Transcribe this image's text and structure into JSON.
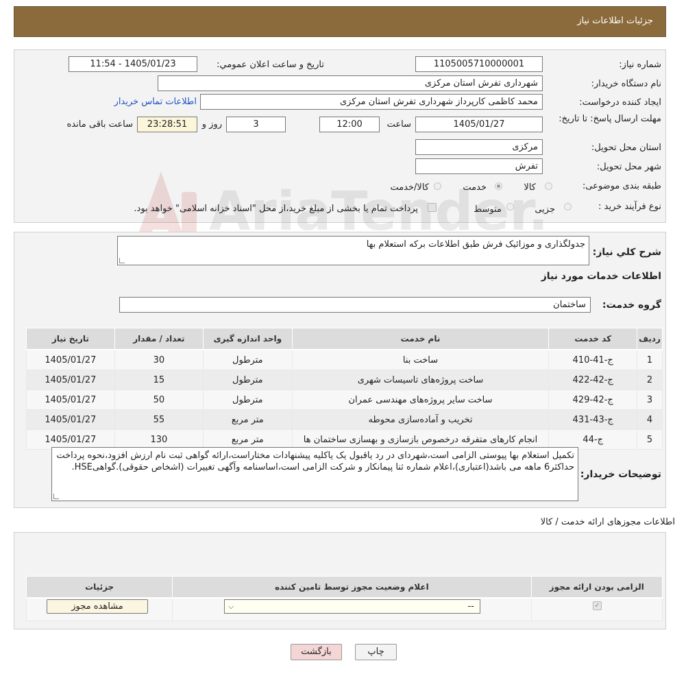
{
  "header": {
    "title": "جزئیات اطلاعات نیاز"
  },
  "form": {
    "need_number_label": "شماره نیاز:",
    "need_number": "1105005710000001",
    "announce_label": "تاریخ و ساعت اعلان عمومي:",
    "announce_value": "1405/01/23 - 11:54",
    "buyer_org_label": "نام دستگاه خريدار:",
    "buyer_org": "شهرداری تفرش استان مرکزی",
    "creator_label": "ايجاد کننده درخواست:",
    "creator": "محمد کاظمی کارپرداز شهرداری تفرش استان مرکزی",
    "contact_link": "اطلاعات تماس خريدار",
    "deadline_label": "مهلت ارسال پاسخ: تا تاریخ:",
    "deadline_date": "1405/01/27",
    "time_label": "ساعت",
    "deadline_time": "12:00",
    "days_value": "3",
    "days_label": "روز و",
    "remaining_value": "23:28:51",
    "remaining_label": "ساعت باقی مانده",
    "province_label": "استان محل تحويل:",
    "province": "مرکزی",
    "city_label": "شهر محل تحويل:",
    "city": "تفرش",
    "category_label": "طبقه بندی موضوعی:",
    "category_options": [
      "کالا",
      "خدمت",
      "کالا/خدمت"
    ],
    "category_selected": "خدمت",
    "process_label": "نوع فرآیند خرید :",
    "process_options": [
      "جزیی",
      "متوسط"
    ],
    "process_note": "پرداخت تمام یا بخشی از مبلغ خرید،از محل \"اسناد خزانه اسلامی\" خواهد بود."
  },
  "summary": {
    "label": "شرح کلي نياز:",
    "text": "جدولگذاری و موزائیک فرش طبق اطلاعات برکه استعلام بها",
    "services_title": "اطلاعات خدمات مورد نياز",
    "group_label": "گروه خدمت:",
    "group_value": "ساختمان"
  },
  "services_table": {
    "headers": [
      "رديف",
      "کد خدمت",
      "نام خدمت",
      "واحد اندازه گيری",
      "تعداد / مقدار",
      "تاریخ نیاز"
    ],
    "rows": [
      [
        "1",
        "ج-41-410",
        "ساخت بنا",
        "مترطول",
        "30",
        "1405/01/27"
      ],
      [
        "2",
        "ج-42-422",
        "ساخت پروژه‌های تاسیسات شهری",
        "مترطول",
        "15",
        "1405/01/27"
      ],
      [
        "3",
        "ج-42-429",
        "ساخت سایر پروژه‌های مهندسی عمران",
        "مترطول",
        "50",
        "1405/01/27"
      ],
      [
        "4",
        "ج-43-431",
        "تخریب و آماده‌سازی محوطه",
        "متر مربع",
        "55",
        "1405/01/27"
      ],
      [
        "5",
        "ج-44",
        "انجام کارهای متفرقه درخصوص بازسازی و بهسازی ساختمان ها",
        "متر مربع",
        "130",
        "1405/01/27"
      ]
    ]
  },
  "buyer_notes": {
    "label": "توضيحات خريدار:",
    "text": "تکمیل استعلام بها پیوستی الزامی است،شهردای در رد یاقبول یک یاکلیه پیشنهادات مختاراست،ارائه گواهی ثبت نام ارزش افزود،نحوه پرداخت حداکثر6 ماهه می باشد(اعتباری)،اعلام شماره ثنا پیمانکار و شرکت الزامی است،اساسنامه وآگهی تغییرات (اشخاص حقوقی).گواهیHSE."
  },
  "permits": {
    "title": "اطلاعات مجوزهای ارائه خدمت / کالا",
    "headers": [
      "الزامی بودن ارائه مجوز",
      "اعلام وضعیت مجوز توسط تامین کننده",
      "جزئيات"
    ],
    "select_value": "--",
    "view_button": "مشاهده مجوز"
  },
  "footer": {
    "print_button": "چاپ",
    "back_button": "بازگشت"
  },
  "watermark": {
    "text": "AriaTender.neT"
  },
  "colors": {
    "header": "#8b6a3c",
    "link": "#1e55c8",
    "back_button": "#f4d6d6"
  }
}
